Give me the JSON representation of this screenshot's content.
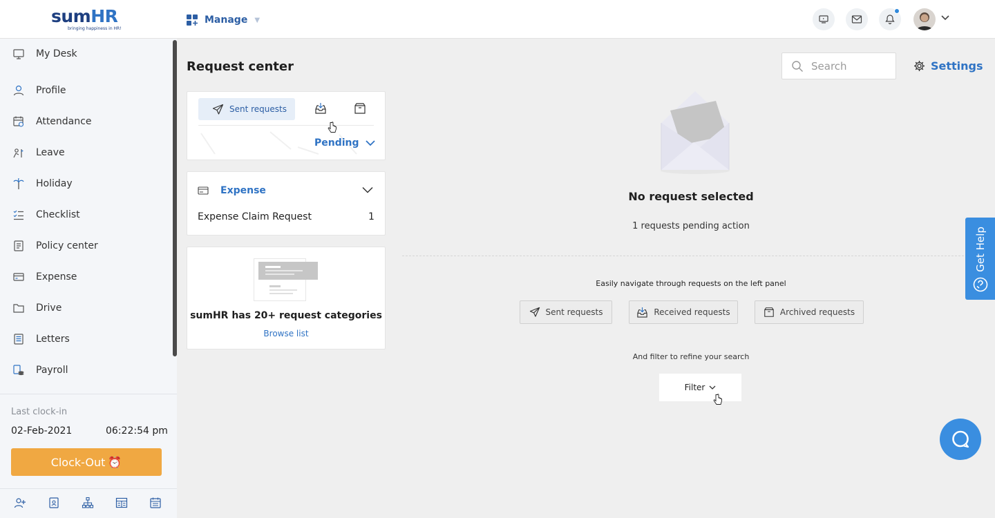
{
  "brand": {
    "word_main": "sum",
    "word_accent": "HR",
    "tagline": "bringing happiness in HR!"
  },
  "header": {
    "manage_label": "Manage"
  },
  "sidebar": {
    "items": [
      {
        "label": "My Desk",
        "icon": "monitor-icon"
      },
      {
        "label": "Profile",
        "icon": "user-icon"
      },
      {
        "label": "Attendance",
        "icon": "calendar-clock-icon"
      },
      {
        "label": "Leave",
        "icon": "leave-icon"
      },
      {
        "label": "Holiday",
        "icon": "palm-tree-icon"
      },
      {
        "label": "Checklist",
        "icon": "checklist-icon"
      },
      {
        "label": "Policy center",
        "icon": "document-icon"
      },
      {
        "label": "Expense",
        "icon": "credit-card-icon"
      },
      {
        "label": "Drive",
        "icon": "folder-icon"
      },
      {
        "label": "Letters",
        "icon": "letters-icon"
      },
      {
        "label": "Payroll",
        "icon": "payroll-icon"
      }
    ],
    "clock": {
      "label": "Last clock-in",
      "date": "02-Feb-2021",
      "time": "06:22:54 pm",
      "button": "Clock-Out",
      "button_emoji": "⏰"
    }
  },
  "main": {
    "title": "Request center",
    "tabs": {
      "sent_label": "Sent requests",
      "status_label": "Pending"
    },
    "expense_group": {
      "title": "Expense",
      "rows": [
        {
          "label": "Expense Claim Request",
          "count": "1"
        }
      ]
    },
    "categories": {
      "title": "sumHR has 20+ request categories",
      "link": "Browse list"
    },
    "search": {
      "placeholder": "Search"
    },
    "settings_label": "Settings",
    "empty": {
      "title": "No request selected",
      "subtitle": "1 requests pending action",
      "nav_hint": "Easily navigate through requests on the left panel",
      "buttons": [
        "Sent requests",
        "Received requests",
        "Archived requests"
      ],
      "filter_hint": "And filter to refine your search",
      "filter_label": "Filter"
    },
    "get_help": "Get Help"
  },
  "colors": {
    "accent": "#2f73c4",
    "clockout": "#f0a842",
    "help": "#3a8ee0"
  }
}
